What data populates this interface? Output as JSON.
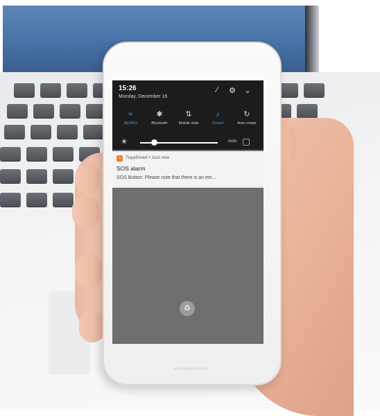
{
  "status": {
    "time": "15:26",
    "date": "Monday, December 16"
  },
  "header_icons": [
    "edit-icon",
    "settings-icon",
    "collapse-icon"
  ],
  "quick_settings": [
    {
      "id": "wifi",
      "label": "SEOKU",
      "icon": "wifi-icon",
      "glyph": "≈",
      "active": true
    },
    {
      "id": "bluetooth",
      "label": "Bluetooth",
      "icon": "bluetooth-icon",
      "glyph": "✱",
      "active": false
    },
    {
      "id": "mobile-data",
      "label": "Mobile data",
      "icon": "mobile-data-icon",
      "glyph": "⇅",
      "active": false
    },
    {
      "id": "sound",
      "label": "Sound",
      "icon": "sound-icon",
      "glyph": "♪",
      "active": true
    },
    {
      "id": "auto-rotate",
      "label": "Auto-rotate",
      "icon": "auto-rotate-icon",
      "glyph": "↻",
      "active": false
    }
  ],
  "brightness": {
    "auto_label": "Auto",
    "level": 0.18
  },
  "notification": {
    "app_line": "TuyaSmart • Just now",
    "title": "SOS alarm",
    "body": "SOS Button: Please note that there is an em..."
  },
  "colors": {
    "active_tile": "#4aa3ff",
    "inactive_tile": "#cfcfcf",
    "app_icon": "#f07a2a",
    "shade_bg": "#1c1c1c",
    "screen_bg": "#6e6e6e"
  }
}
